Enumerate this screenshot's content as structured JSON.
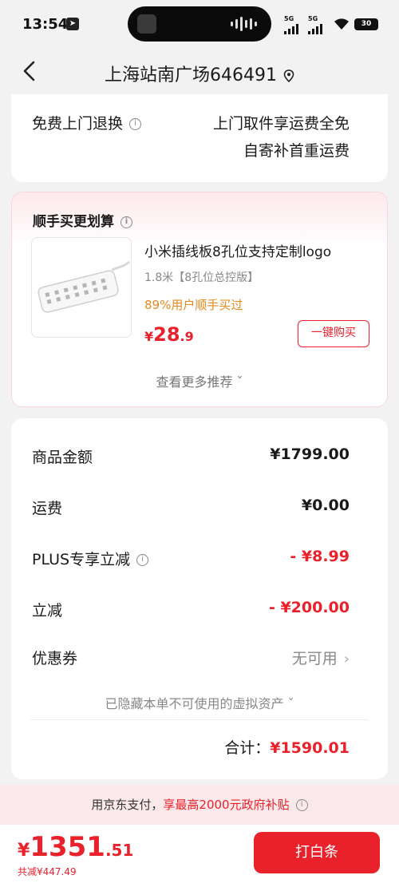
{
  "status_bar": {
    "time": "13:54",
    "network_1": "5G",
    "network_2": "5G",
    "battery": "30"
  },
  "nav": {
    "title": "上海站南广场646491"
  },
  "return_card": {
    "label": "免费上门退换",
    "line1": "上门取件享运费全免",
    "line2": "自寄补首重运费"
  },
  "recommend": {
    "header": "顺手买更划算",
    "product_name": "小米插线板8孔位支持定制logo",
    "product_spec": "1.8米【8孔位总控版】",
    "bought_hint": "89%用户顺手买过",
    "price_symbol": "¥",
    "price_int": "28",
    "price_dec": ".9",
    "buy_button": "一键购买",
    "more_label": "查看更多推荐 ˇ"
  },
  "summary": {
    "rows": [
      {
        "key": "商品金额",
        "value": "¥1799.00"
      },
      {
        "key": "运费",
        "value": "¥0.00"
      },
      {
        "key": "PLUS专享立减",
        "value": "- ¥8.99"
      },
      {
        "key": "立减",
        "value": "- ¥200.00"
      },
      {
        "key": "优惠券",
        "value": "无可用"
      }
    ],
    "hidden_assets": "已隐藏本单不可使用的虚拟资产 ˇ",
    "total_label": "合计：",
    "total_value": "¥1590.01"
  },
  "subsidy": {
    "prefix": "用京东支付，",
    "highlight": "享最高2000元政府补贴"
  },
  "bottom": {
    "price_symbol": "¥",
    "price_int": "1351",
    "price_dec": ".51",
    "saved": "共减¥447.49",
    "pay_button": "打白条"
  },
  "colors": {
    "accent": "#e8212b",
    "orange_hint": "#e38a1e",
    "background": "#f2f2f2"
  }
}
